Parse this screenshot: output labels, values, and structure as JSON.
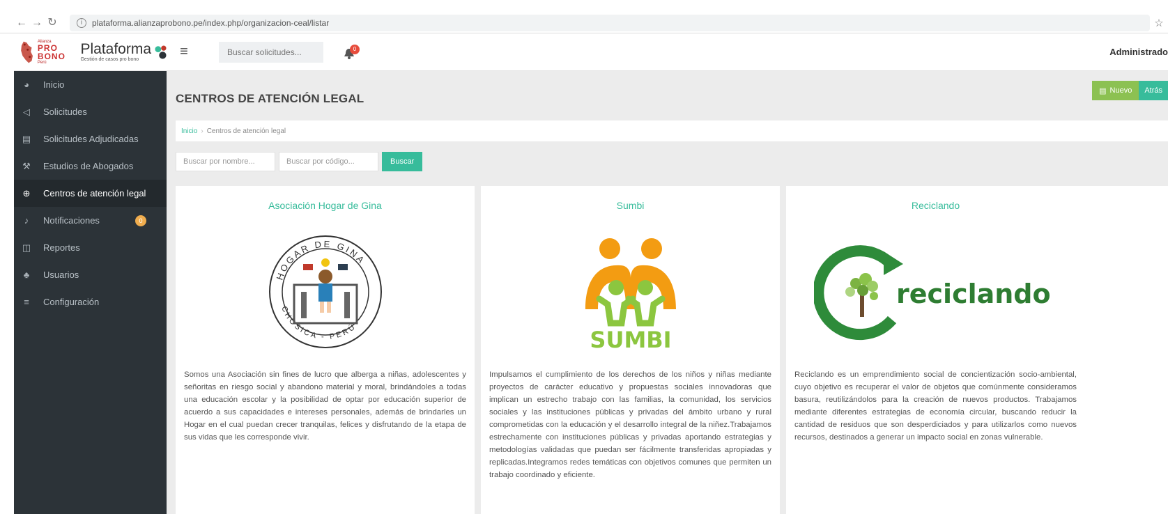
{
  "browser": {
    "url": "plataforma.alianzaprobono.pe/index.php/organizacion-ceal/listar"
  },
  "header": {
    "brand_small_top": "Alianza",
    "brand_main": "PRO BONO",
    "brand_small_bottom": "Perú",
    "app_name": "Plataforma",
    "app_subtitle": "Gestión de casos pro bono",
    "search_placeholder": "Buscar solicitudes...",
    "notif_count": "0",
    "user": "Administrado"
  },
  "sidebar": {
    "items": [
      {
        "label": "Inicio",
        "icon": "dashboard-icon"
      },
      {
        "label": "Solicitudes",
        "icon": "megaphone-icon"
      },
      {
        "label": "Solicitudes Adjudicadas",
        "icon": "document-icon"
      },
      {
        "label": "Estudios de Abogados",
        "icon": "gavel-icon"
      },
      {
        "label": "Centros de atención legal",
        "icon": "globe-icon",
        "active": true
      },
      {
        "label": "Notificaciones",
        "icon": "bell-icon",
        "badge": "0"
      },
      {
        "label": "Reportes",
        "icon": "reports-icon"
      },
      {
        "label": "Usuarios",
        "icon": "users-icon"
      },
      {
        "label": "Configuración",
        "icon": "sliders-icon"
      }
    ]
  },
  "main": {
    "title": "CENTROS DE ATENCIÓN LEGAL",
    "new_button": "Nuevo",
    "back_button": "Atrás",
    "breadcrumb": {
      "home": "Inicio",
      "current": "Centros de atención legal"
    },
    "filters": {
      "name_placeholder": "Buscar por nombre...",
      "code_placeholder": "Buscar por código...",
      "search_button": "Buscar"
    },
    "cards": [
      {
        "title": "Asociación Hogar de Gina",
        "logo": "hogar-de-gina-logo",
        "logo_text_top": "HOGAR DE GINA",
        "logo_text_bottom": "CHOSICA - PERÚ",
        "description": "Somos una Asociación sin fines de lucro que alberga a niñas, adolescentes y señoritas en riesgo social y abandono material y moral, brindándoles a todas una educación escolar y la posibilidad de optar por educación superior de acuerdo a sus capacidades e intereses personales, además de brindarles un Hogar en el cual puedan crecer tranquilas, felices y disfrutando de la etapa de sus vidas que les corresponde vivir."
      },
      {
        "title": "Sumbi",
        "logo": "sumbi-logo",
        "logo_text": "SUMBI",
        "description": "Impulsamos el cumplimiento de los derechos de los niños y niñas mediante proyectos de carácter educativo y propuestas sociales innovadoras que implican un estrecho trabajo con las familias, la comunidad, los servicios sociales y las instituciones públicas y privadas del ámbito urbano y rural comprometidas con la educación y el desarrollo integral de la niñez.Trabajamos estrechamente con instituciones públicas y privadas aportando estrategias y metodologías validadas que puedan ser fácilmente transferidas apropiadas y replicadas.Integramos redes temáticas con objetivos comunes que permiten un trabajo coordinado y eficiente."
      },
      {
        "title": "Reciclando",
        "logo": "reciclando-logo",
        "logo_text": "reciclando",
        "description": "Reciclando es un emprendimiento social de concientización socio-ambiental, cuyo objetivo es recuperar el valor de objetos que comúnmente consideramos basura, reutilizándolos para la creación de nuevos productos. Trabajamos mediante diferentes estrategias de economía circular, buscando reducir la cantidad de residuos que son desperdiciados y para utilizarlos como nuevos recursos, destinados a generar un impacto social en zonas vulnerable."
      }
    ]
  },
  "colors": {
    "accent": "#37bc9b",
    "new_button": "#8cc152",
    "sidebar_bg": "#2c3338",
    "badge": "#f0ad4e",
    "sumbi_orange": "#f39c12",
    "sumbi_green": "#8cc63f",
    "reciclando_green": "#2e8b3a"
  }
}
